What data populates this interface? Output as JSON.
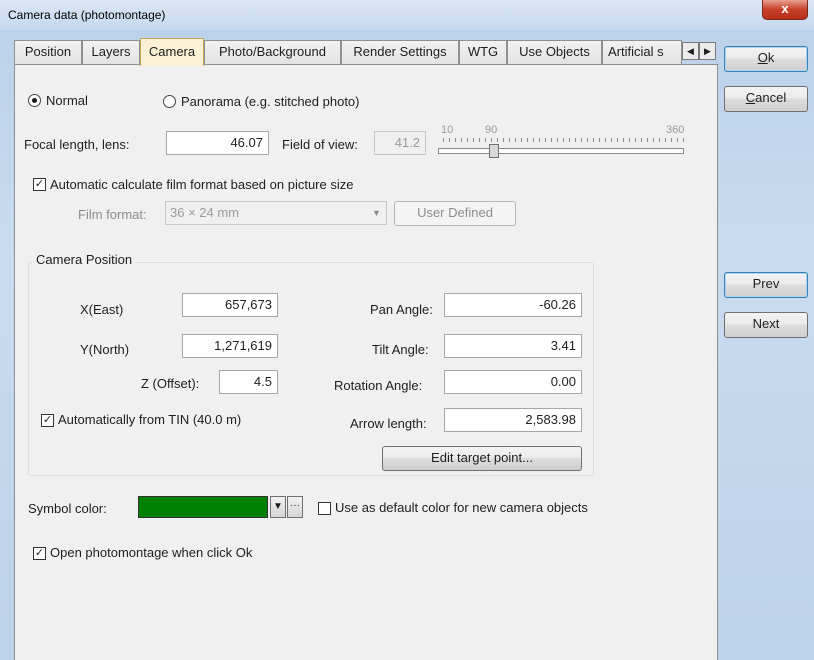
{
  "window": {
    "title": "Camera data  (photomontage)",
    "close": "x"
  },
  "tabs": [
    {
      "label": "Position"
    },
    {
      "label": "Layers"
    },
    {
      "label": "Camera"
    },
    {
      "label": "Photo/Background"
    },
    {
      "label": "Render Settings"
    },
    {
      "label": "WTG"
    },
    {
      "label": "Use Objects"
    },
    {
      "label": "Artificial s"
    }
  ],
  "tab_scroll": {
    "left": "◀",
    "right": "▶"
  },
  "side_buttons": {
    "ok_accel": "O",
    "ok_rest": "k",
    "cancel_accel": "C",
    "cancel_rest": "ancel",
    "prev": "Prev",
    "next": "Next"
  },
  "mode": {
    "normal": "Normal",
    "panorama": "Panorama (e.g. stitched photo)",
    "selected": "normal"
  },
  "lens": {
    "focal_label": "Focal length, lens:",
    "focal_value": "46.07",
    "fov_label": "Field of view:",
    "fov_value": "41.2",
    "scale_min": "10",
    "scale_mid": "90",
    "scale_max": "360"
  },
  "film": {
    "auto_label": "Automatic calculate film format based on picture size",
    "auto_checked": true,
    "format_label": "Film format:",
    "format_value": "36 × 24 mm",
    "user_defined": "User Defined"
  },
  "camera_position": {
    "title": "Camera Position",
    "x_label": "X(East)",
    "x_value": "657,673",
    "y_label": "Y(North)",
    "y_value": "1,271,619",
    "z_label": "Z (Offset):",
    "z_value": "4.5",
    "auto_tin_label": "Automatically from TIN (40.0 m)",
    "auto_tin_checked": true,
    "pan_label": "Pan Angle:",
    "pan_value": "-60.26",
    "tilt_label": "Tilt Angle:",
    "tilt_value": "3.41",
    "rotation_label": "Rotation Angle:",
    "rotation_value": "0.00",
    "arrow_label": "Arrow length:",
    "arrow_value": "2,583.98",
    "edit_target": "Edit target point..."
  },
  "symbol": {
    "label": "Symbol color:",
    "color": "#008000",
    "dots": "···",
    "default_label": "Use as default color for new camera objects",
    "default_checked": false
  },
  "open_montage": {
    "label": "Open photomontage when click Ok",
    "checked": true
  }
}
